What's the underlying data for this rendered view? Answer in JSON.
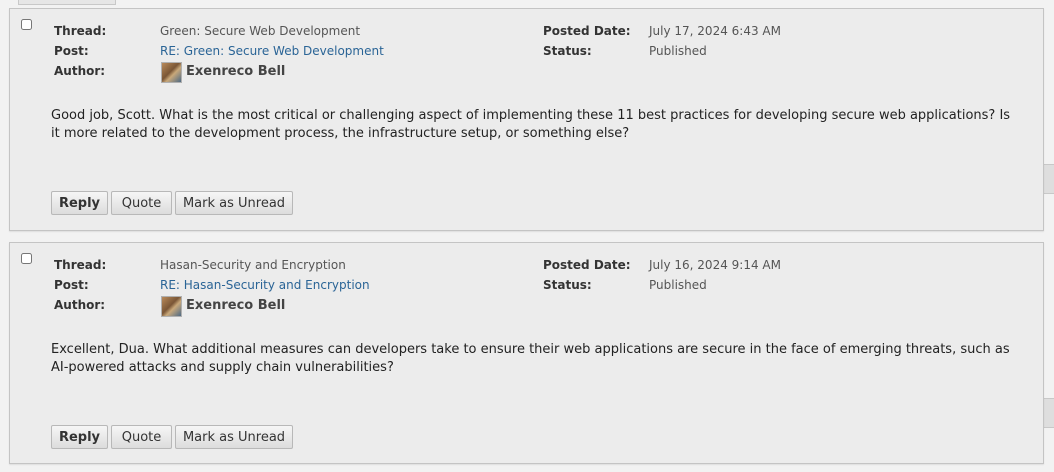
{
  "labels": {
    "thread": "Thread:",
    "post": "Post:",
    "author": "Author:",
    "posted_date": "Posted Date:",
    "status": "Status:"
  },
  "buttons": {
    "reply": "Reply",
    "quote": "Quote",
    "mark_unread": "Mark as Unread"
  },
  "posts": [
    {
      "thread": "Green: Secure Web Development",
      "post": "RE: Green: Secure Web Development",
      "author": "Exenreco Bell",
      "posted_date": "July 17, 2024 6:43 AM",
      "status": "Published",
      "body": "Good job, Scott. What is the most critical or challenging aspect of implementing these 11 best practices for developing secure web applications? Is it more related to the development process, the infrastructure setup, or something else?"
    },
    {
      "thread": "Hasan-Security and Encryption",
      "post": "RE: Hasan-Security and Encryption",
      "author": "Exenreco Bell",
      "posted_date": "July 16, 2024 9:14 AM",
      "status": "Published",
      "body": "Excellent, Dua. What additional measures can developers take to ensure their web applications are secure in the face of emerging threats, such as AI-powered attacks and supply chain vulnerabilities?"
    }
  ]
}
